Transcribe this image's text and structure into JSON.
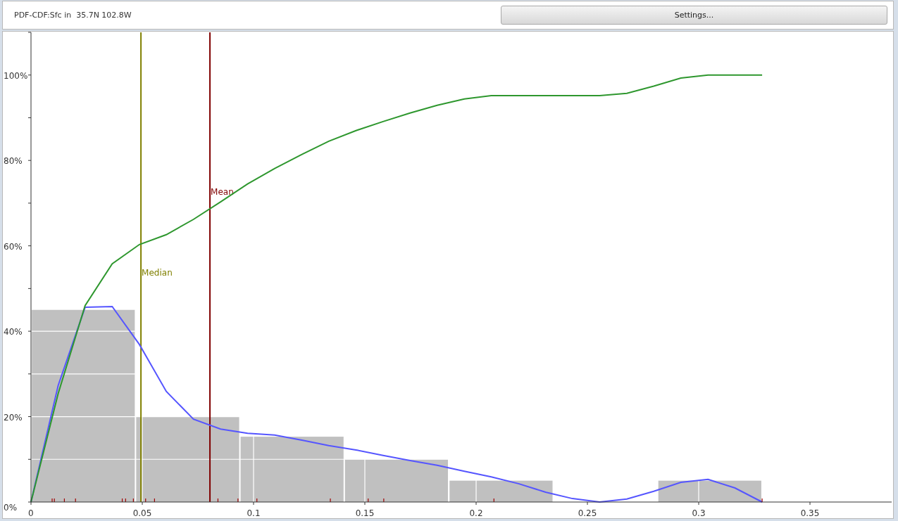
{
  "header": {
    "title": "PDF-CDF:Sfc in  35.7N 102.8W",
    "settings_button": "Settings..."
  },
  "chart": {
    "chart_data": {
      "type": "line",
      "xlim": [
        0,
        0.3867
      ],
      "ylim": [
        0,
        110
      ],
      "grid": true,
      "xticks": [
        {
          "value": 0,
          "label": "0"
        },
        {
          "value": 0.05,
          "label": "0.05"
        },
        {
          "value": 0.1,
          "label": "0.1"
        },
        {
          "value": 0.15,
          "label": "0.15"
        },
        {
          "value": 0.2,
          "label": "0.2"
        },
        {
          "value": 0.25,
          "label": "0.25"
        },
        {
          "value": 0.3,
          "label": "0.3"
        },
        {
          "value": 0.35,
          "label": "0.35"
        }
      ],
      "yticks": [
        {
          "value": 0,
          "label": "0%"
        },
        {
          "value": 20,
          "label": "20%"
        },
        {
          "value": 40,
          "label": "40%"
        },
        {
          "value": 60,
          "label": "60%"
        },
        {
          "value": 80,
          "label": "80%"
        },
        {
          "value": 100,
          "label": "100%"
        }
      ],
      "x": [
        0,
        0.0122,
        0.0243,
        0.0365,
        0.0487,
        0.0608,
        0.073,
        0.0852,
        0.0973,
        0.1095,
        0.1217,
        0.1338,
        0.146,
        0.1582,
        0.1703,
        0.1825,
        0.1947,
        0.2068,
        0.219,
        0.2312,
        0.2433,
        0.2555,
        0.2677,
        0.2798,
        0.292,
        0.3042,
        0.3163,
        0.3285
      ],
      "series": [
        {
          "type": "bar",
          "color": "#c0c0c0",
          "x": [
            0.0235,
            0.0704,
            0.1173,
            0.1642,
            0.2112,
            0.2581,
            0.305
          ],
          "values": [
            45,
            20,
            15.3,
            10,
            5,
            0,
            5
          ]
        },
        {
          "color": "#5555ff",
          "values": [
            0,
            27.3,
            45.6,
            45.8,
            36.9,
            25.9,
            19.4,
            17.1,
            16.1,
            15.7,
            14.5,
            13.2,
            12.2,
            10.9,
            9.7,
            8.6,
            7.2,
            5.9,
            4.3,
            2.3,
            0.8,
            0,
            0.7,
            2.5,
            4.6,
            5.3,
            3.3,
            0
          ]
        },
        {
          "color": "#2e972e",
          "values": [
            0,
            25.4,
            46,
            55.8,
            60.3,
            62.6,
            66.2,
            70.3,
            74.5,
            78.1,
            81.4,
            84.5,
            87,
            89.1,
            91.1,
            92.9,
            94.4,
            95.2,
            95.2,
            95.2,
            95.2,
            95.2,
            95.7,
            97.4,
            99.3,
            100,
            100,
            100
          ]
        }
      ],
      "ref_lines": [
        {
          "axis": "x",
          "value": 0.0494,
          "label": "Median",
          "color": "#808000"
        },
        {
          "axis": "x",
          "value": 0.0804,
          "label": "Mean",
          "color": "#800000"
        }
      ]
    }
  }
}
